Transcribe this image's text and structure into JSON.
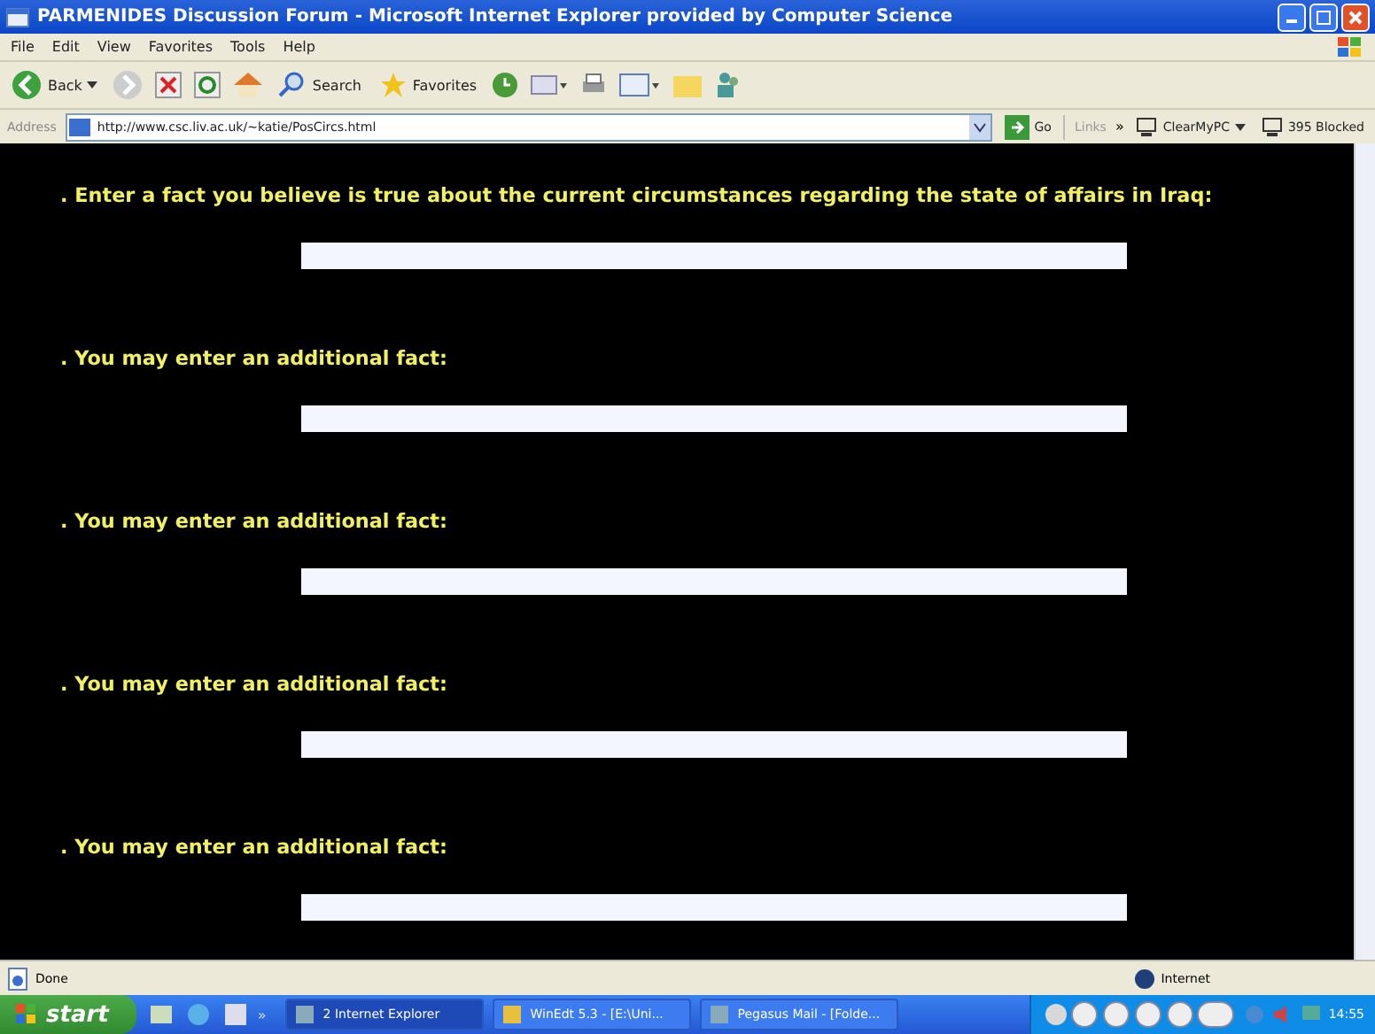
{
  "window": {
    "title": "PARMENIDES Discussion Forum - Microsoft Internet Explorer provided by Computer Science"
  },
  "menu": [
    "File",
    "Edit",
    "View",
    "Favorites",
    "Tools",
    "Help"
  ],
  "toolbar": {
    "back": "Back",
    "search": "Search",
    "favorites": "Favorites"
  },
  "address_bar": {
    "label": "Address",
    "url": "http://www.csc.liv.ac.uk/~katie/PosCircs.html",
    "go": "Go",
    "links": "Links",
    "chevron": "»",
    "clearmypc": "ClearMyPC",
    "blocked": "395 Blocked"
  },
  "questions": [
    {
      "prompt": ". Enter a fact you believe is true about the current circumstances regarding the state of affairs in Iraq:"
    },
    {
      "prompt": ". You may enter an additional fact:"
    },
    {
      "prompt": ". You may enter an additional fact:"
    },
    {
      "prompt": ". You may enter an additional fact:"
    },
    {
      "prompt": ". You may enter an additional fact:"
    }
  ],
  "status_bar": {
    "status": "Done",
    "zone": "Internet"
  },
  "taskbar": {
    "start": "start",
    "chevron": "»",
    "tasks": [
      {
        "label": "2 Internet Explorer",
        "selected": true
      },
      {
        "label": "WinEdt 5.3 - [E:\\Uni...",
        "selected": false
      },
      {
        "label": "Pegasus Mail - [Folde...",
        "selected": false
      }
    ],
    "clock": "14:55"
  }
}
